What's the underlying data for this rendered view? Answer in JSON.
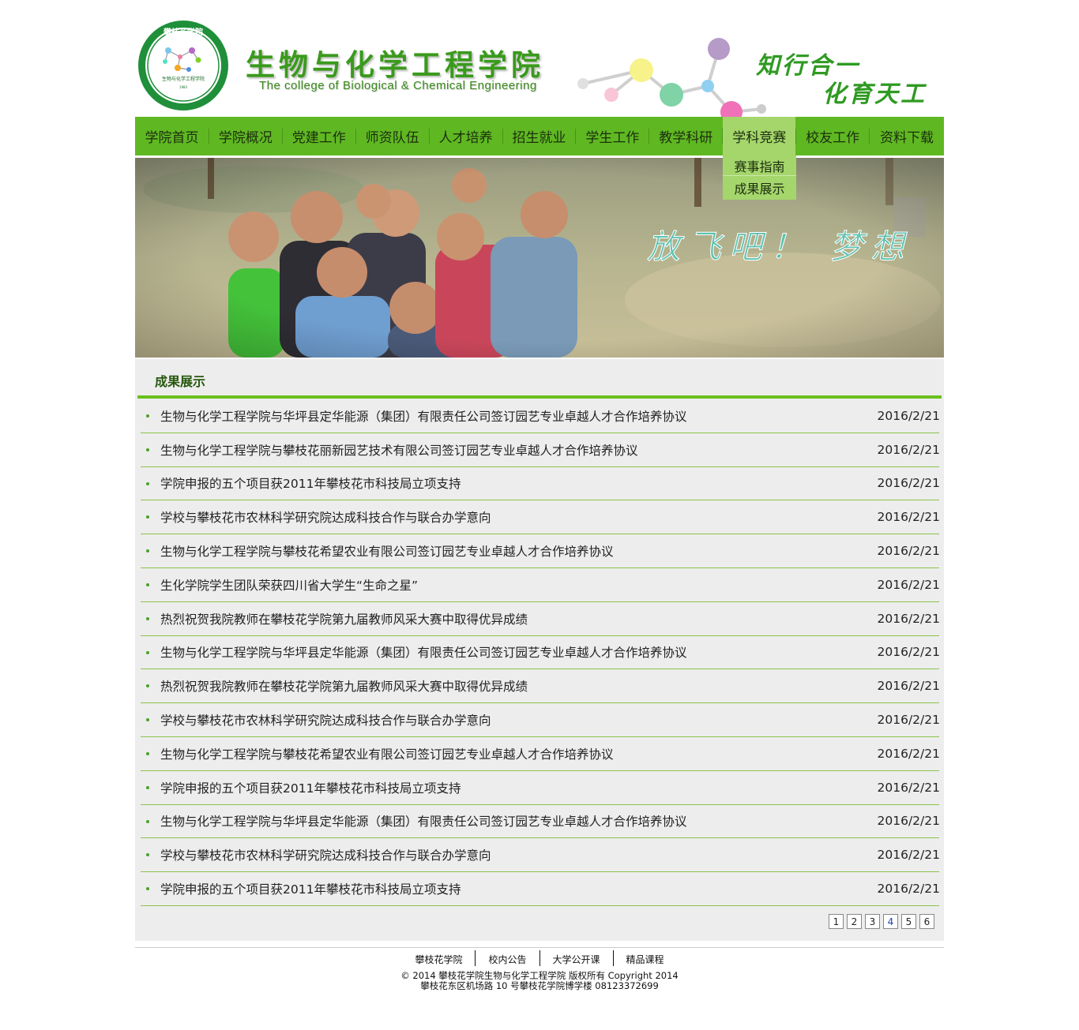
{
  "header": {
    "logo_text_top": "攀枝花学院",
    "logo_text_inner": "生物与化学工程学院",
    "logo_text_ring": "PanZhiHua University",
    "logo_year": "1983",
    "title_cn": "生物与化学工程学院",
    "title_en": "The college of Biological & Chemical Engineering",
    "motto_line1": "知行合一",
    "motto_line2": "化育天工",
    "brand_color": "#5fb822"
  },
  "nav": {
    "items": [
      {
        "label": "学院首页"
      },
      {
        "label": "学院概况"
      },
      {
        "label": "党建工作"
      },
      {
        "label": "师资队伍"
      },
      {
        "label": "人才培养"
      },
      {
        "label": "招生就业"
      },
      {
        "label": "学生工作"
      },
      {
        "label": "教学科研"
      },
      {
        "label": "学科竞赛",
        "active": true
      },
      {
        "label": "校友工作"
      },
      {
        "label": "资料下载"
      }
    ],
    "dropdown": [
      {
        "label": "赛事指南"
      },
      {
        "label": "成果展示"
      }
    ]
  },
  "banner": {
    "slogan": "放飞吧！ 梦想"
  },
  "main": {
    "section_title": "成果展示",
    "rows": [
      {
        "title": "生物与化学工程学院与华坪县定华能源（集团）有限责任公司签订园艺专业卓越人才合作培养协议",
        "date": "2016/2/21"
      },
      {
        "title": "生物与化学工程学院与攀枝花丽新园艺技术有限公司签订园艺专业卓越人才合作培养协议",
        "date": "2016/2/21"
      },
      {
        "title": "学院申报的五个项目获2011年攀枝花市科技局立项支持",
        "date": "2016/2/21"
      },
      {
        "title": "学校与攀枝花市农林科学研究院达成科技合作与联合办学意向",
        "date": "2016/2/21"
      },
      {
        "title": "生物与化学工程学院与攀枝花希望农业有限公司签订园艺专业卓越人才合作培养协议",
        "date": "2016/2/21"
      },
      {
        "title": "生化学院学生团队荣获四川省大学生“生命之星”",
        "date": "2016/2/21"
      },
      {
        "title": "热烈祝贺我院教师在攀枝花学院第九届教师风采大赛中取得优异成绩",
        "date": "2016/2/21"
      },
      {
        "title": "生物与化学工程学院与华坪县定华能源（集团）有限责任公司签订园艺专业卓越人才合作培养协议",
        "date": "2016/2/21"
      },
      {
        "title": "热烈祝贺我院教师在攀枝花学院第九届教师风采大赛中取得优异成绩",
        "date": "2016/2/21"
      },
      {
        "title": "学校与攀枝花市农林科学研究院达成科技合作与联合办学意向",
        "date": "2016/2/21"
      },
      {
        "title": "生物与化学工程学院与攀枝花希望农业有限公司签订园艺专业卓越人才合作培养协议",
        "date": "2016/2/21"
      },
      {
        "title": "学院申报的五个项目获2011年攀枝花市科技局立项支持",
        "date": "2016/2/21"
      },
      {
        "title": "生物与化学工程学院与华坪县定华能源（集团）有限责任公司签订园艺专业卓越人才合作培养协议",
        "date": "2016/2/21"
      },
      {
        "title": "学校与攀枝花市农林科学研究院达成科技合作与联合办学意向",
        "date": "2016/2/21"
      },
      {
        "title": "学院申报的五个项目获2011年攀枝花市科技局立项支持",
        "date": "2016/2/21"
      }
    ],
    "pages": [
      "1",
      "2",
      "3",
      "4",
      "5",
      "6"
    ],
    "current_page": "4"
  },
  "footer": {
    "links": [
      "攀枝花学院",
      "校内公告",
      "大学公开课",
      "精品课程"
    ],
    "copyright": "© 2014 攀枝花学院生物与化学工程学院 版权所有 Copyright 2014",
    "address": "攀枝花东区机场路 10 号攀枝花学院博学楼 08123372699"
  }
}
